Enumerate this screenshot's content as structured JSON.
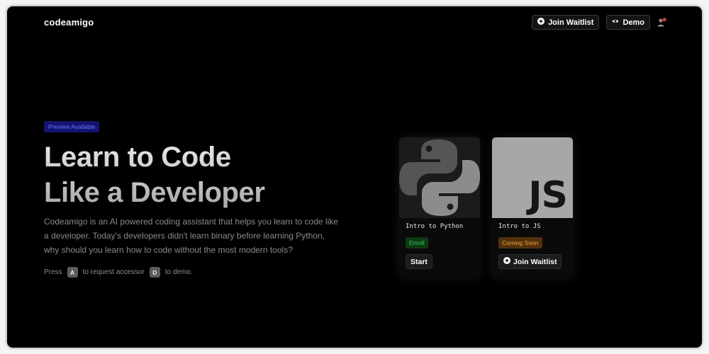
{
  "brand": "codeamigo",
  "nav": {
    "join_waitlist_label": "Join Waitlist",
    "demo_label": "Demo"
  },
  "hero": {
    "badge": "Preview Available",
    "title_line1": "Learn to Code",
    "title_line2": "Like a Developer",
    "description": "Codeamigo is an AI powered coding assistant that helps you learn to code like a developer. Today's developers didn't learn binary before learning Python, why should you learn how to code without the most modern tools?",
    "hint": {
      "press": "Press",
      "key_a": "A",
      "middle": "to request accessor",
      "key_d": "D",
      "end": "to demo."
    }
  },
  "cards": [
    {
      "title": "Intro to Python",
      "status": "Enroll",
      "button": "Start",
      "icon": "python-logo-icon"
    },
    {
      "title": "Intro to JS",
      "status": "Coming Soon",
      "button": "Join Waitlist",
      "logo_text": "JS",
      "icon": "js-logo-icon"
    }
  ],
  "colors": {
    "background": "#000000",
    "badge_bg": "#131470",
    "badge_text": "#6e78ff",
    "enroll_bg": "#0e3a14",
    "enroll_text": "#3bcc57",
    "coming_soon_bg": "#52310c",
    "coming_soon_text": "#f6a23a"
  }
}
